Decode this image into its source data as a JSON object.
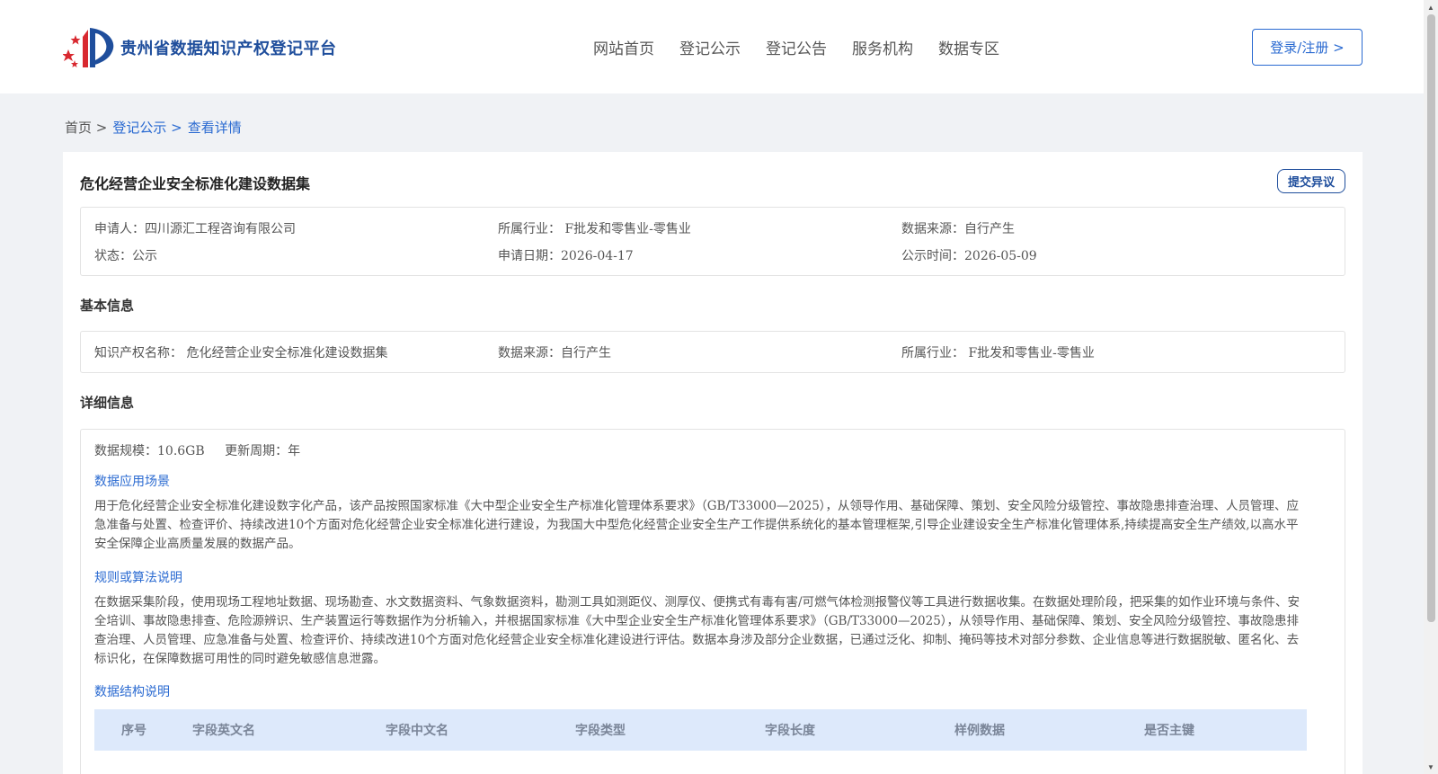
{
  "header": {
    "logo_text": "贵州省数据知识产权登记平台",
    "nav": [
      "网站首页",
      "登记公示",
      "登记公告",
      "服务机构",
      "数据专区"
    ],
    "login_label": "登录/注册 >"
  },
  "breadcrumb": {
    "home": "首页 >",
    "list": "登记公示 >",
    "current": "查看详情"
  },
  "detail": {
    "title": "危化经营企业安全标准化建设数据集",
    "objection_label": "提交异议",
    "summary": {
      "applicant": "申请人：四川源汇工程咨询有限公司",
      "industry": "所属行业： F批发和零售业-零售业",
      "source": "数据来源：自行产生",
      "status": "状态：公示",
      "apply_date": "申请日期：2026-04-17",
      "publish_time": "公示时间：2026-05-09"
    },
    "basic_title": "基本信息",
    "basic": {
      "ip_name": "知识产权名称： 危化经营企业安全标准化建设数据集",
      "source": "数据来源：自行产生",
      "industry": "所属行业： F批发和零售业-零售业"
    },
    "detail_title": "详细信息",
    "scale": "数据规模：10.6GB",
    "cycle": "更新周期：年",
    "scene_title": "数据应用场景",
    "scene_text": "用于危化经营企业安全标准化建设数字化产品，该产品按照国家标准《大中型企业安全生产标准化管理体系要求》（GB/T33000—2025），从领导作用、基础保障、策划、安全风险分级管控、事故隐患排查治理、人员管理、应急准备与处置、检查评价、持续改进10个方面对危化经营企业安全标准化进行建设，为我国大中型危化经营企业安全生产工作提供系统化的基本管理框架,引导企业建设安全生产标准化管理体系,持续提高安全生产绩效,以高水平安全保障企业高质量发展的数据产品。",
    "rule_title": "规则或算法说明",
    "rule_text": "在数据采集阶段，使用现场工程地址数据、现场勘查、水文数据资料、气象数据资料，勘测工具如测距仪、测厚仪、便携式有毒有害/可燃气体检测报警仪等工具进行数据收集。在数据处理阶段，把采集的如作业环境与条件、安全培训、事故隐患排查、危险源辨识、生产装置运行等数据作为分析输入，并根据国家标准《大中型企业安全生产标准化管理体系要求》（GB/T33000—2025），从领导作用、基础保障、策划、安全风险分级管控、事故隐患排查治理、人员管理、应急准备与处置、检查评价、持续改进10个方面对危化经营企业安全标准化建设进行评估。数据本身涉及部分企业数据，已通过泛化、抑制、掩码等技术对部分参数、企业信息等进行数据脱敏、匿名化、去标识化，在保障数据可用性的同时避免敏感信息泄露。",
    "structure_title": "数据结构说明",
    "table_headers": [
      "序号",
      "字段英文名",
      "字段中文名",
      "字段类型",
      "字段长度",
      "样例数据",
      "是否主键"
    ]
  },
  "colors": {
    "accent": "#2a6ad1",
    "brand": "#1f4e9c",
    "table_head_bg": "#dde9fb"
  }
}
